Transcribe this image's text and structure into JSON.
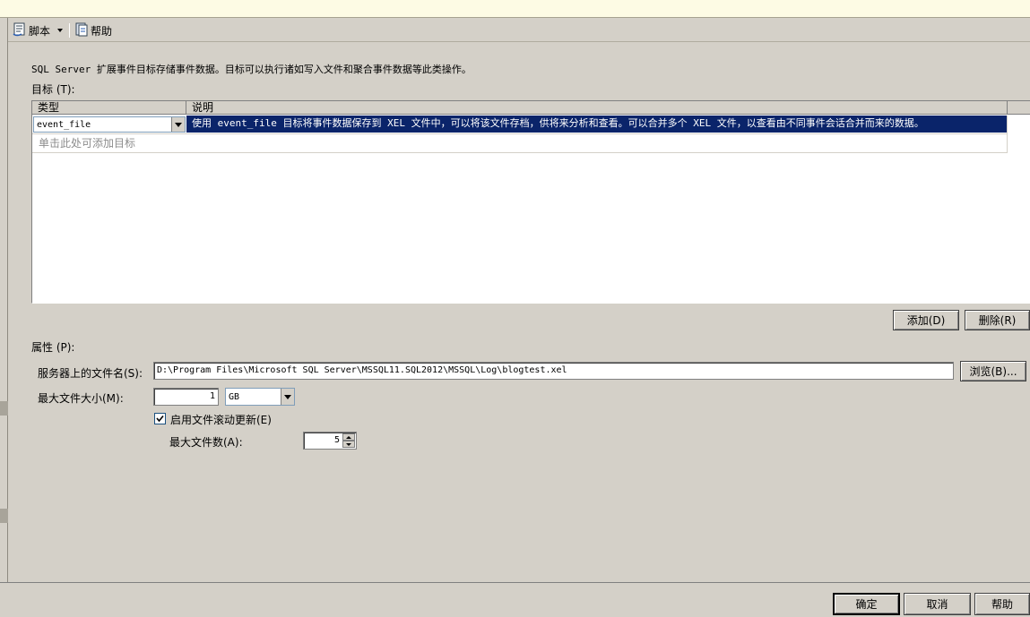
{
  "toolbar": {
    "script_label": "脚本",
    "help_label": "帮助"
  },
  "description": "SQL Server 扩展事件目标存储事件数据。目标可以执行诸如写入文件和聚合事件数据等此类操作。",
  "targets_label": "目标 (T):",
  "grid": {
    "columns": [
      "类型",
      "说明"
    ],
    "rows": [
      {
        "type": "event_file",
        "description": "使用 event_file 目标将事件数据保存到 XEL 文件中，可以将该文件存档，供将来分析和查看。可以合并多个 XEL 文件，以查看由不同事件会话合并而来的数据。"
      }
    ],
    "add_hint": "单击此处可添加目标"
  },
  "buttons": {
    "add": "添加(D)",
    "remove": "删除(R)",
    "browse": "浏览(B)...",
    "ok": "确定",
    "cancel": "取消",
    "help": "帮助"
  },
  "properties_label": "属性 (P):",
  "file_name_label": "服务器上的文件名(S):",
  "file_name_value": "D:\\Program Files\\Microsoft SQL Server\\MSSQL11.SQL2012\\MSSQL\\Log\\blogtest.xel",
  "max_size_label": "最大文件大小(M):",
  "max_size_value": "1",
  "max_size_unit": "GB",
  "rollover_label": "启用文件滚动更新(E)",
  "rollover_checked": true,
  "max_files_label": "最大文件数(A):",
  "max_files_value": "5"
}
